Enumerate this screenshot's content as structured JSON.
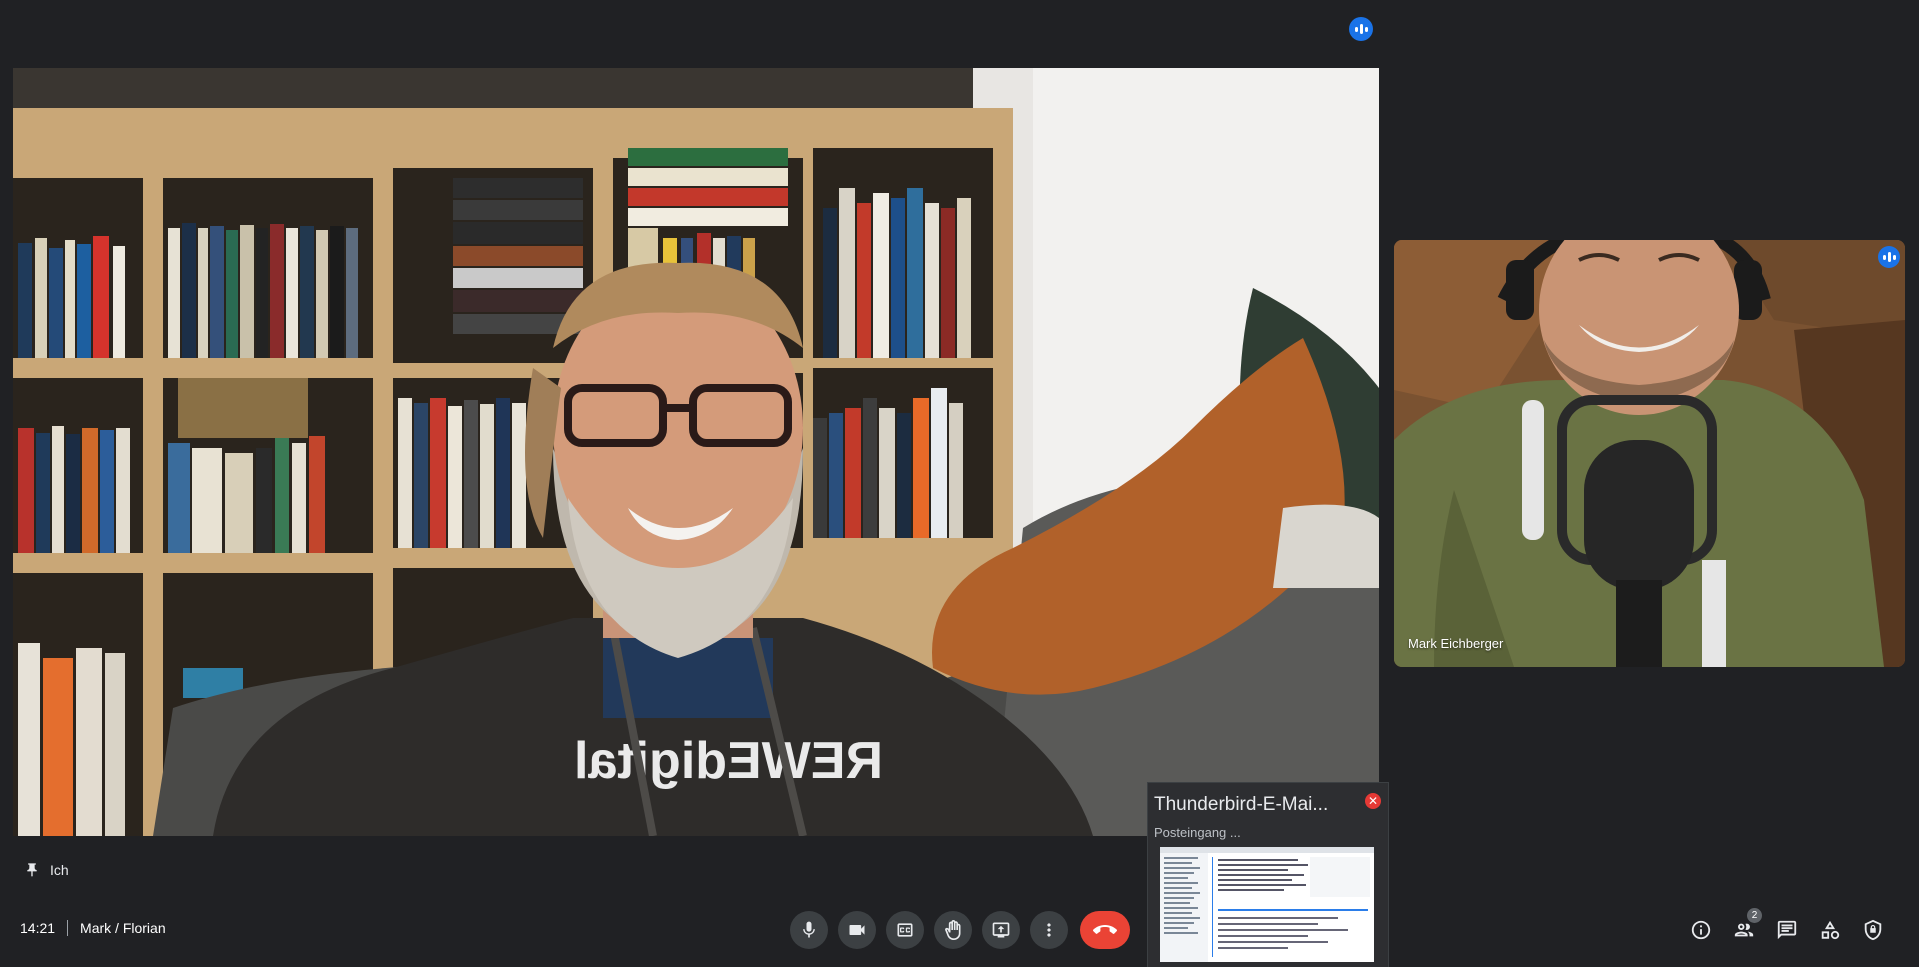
{
  "colors": {
    "background": "#202124",
    "accent_blue": "#1a73e8",
    "hangup_red": "#ea4335",
    "control_bg": "#3c4043"
  },
  "top": {
    "speaking_icon": "speaking-indicator-icon"
  },
  "main_tile": {
    "self_label": "Ich",
    "pin_icon": "pin-icon"
  },
  "side_tile": {
    "participant_name": "Mark Eichberger",
    "speaking_icon": "speaking-indicator-icon"
  },
  "meeting": {
    "time": "14:21",
    "title": "Mark / Florian"
  },
  "controls": [
    {
      "name": "microphone",
      "icon": "mic-icon"
    },
    {
      "name": "camera",
      "icon": "camera-icon"
    },
    {
      "name": "captions",
      "icon": "captions-icon"
    },
    {
      "name": "raise-hand",
      "icon": "hand-icon"
    },
    {
      "name": "present",
      "icon": "present-screen-icon"
    },
    {
      "name": "more-options",
      "icon": "more-vert-icon"
    },
    {
      "name": "leave-call",
      "icon": "call-end-icon"
    }
  ],
  "right_panel": {
    "info_icon": "info-icon",
    "people_icon": "people-icon",
    "people_count": "2",
    "chat_icon": "chat-icon",
    "activities_icon": "activities-icon",
    "host_controls_icon": "shield-lock-icon"
  },
  "preview": {
    "title": "Thunderbird-E-Mai...",
    "subtitle": "Posteingang ...",
    "close_icon": "close-icon"
  }
}
